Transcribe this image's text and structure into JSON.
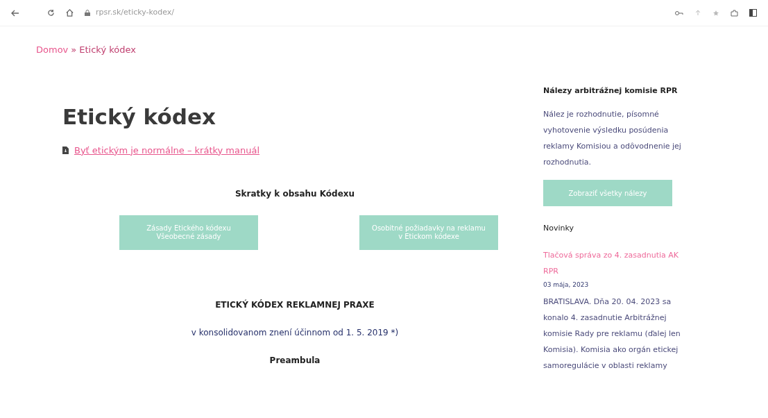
{
  "browser": {
    "address": "rpsr.sk/eticky-kodex/"
  },
  "breadcrumb": [
    {
      "label": "Domov",
      "kind": "link"
    },
    {
      "label": "»",
      "kind": "text"
    },
    {
      "label": "Etický kódex",
      "kind": "text"
    }
  ],
  "page": {
    "title": "Etický kódex",
    "download_link": "Byť etickým je normálne – krátky manuál",
    "shortcuts_heading": "Skratky k obsahu Kódexu",
    "shortcut_buttons": [
      {
        "line1": "Zásady Etického kódexu",
        "line2": "Všeobecné zásady"
      },
      {
        "line1": "Osobitné požiadavky na reklamu",
        "line2": "v Etickom kódexe"
      }
    ],
    "code_title": "ETICKÝ KÓDEX REKLAMNEJ PRAXE",
    "code_subtitle": "v konsolidovanom znení účinnom od 1. 5. 2019 *)",
    "section": "Preambula"
  },
  "sidebar": {
    "findings": {
      "title": "Nálezy arbitrážnej komisie RPR",
      "text": "Nález je rozhodnutie, písomné vyhotovenie výsledku posúdenia reklamy Komisiou a odôvodnenie jej rozhodnutia.",
      "button": "Zobraziť všetky nálezy"
    },
    "news": {
      "title": "Novinky",
      "items": [
        {
          "headline": "Tlačová správa zo 4. zasadnutia AK RPR",
          "date": "03 mája, 2023",
          "text": "BRATISLAVA. Dňa 20. 04. 2023 sa konalo 4. zasadnutie Arbitrážnej komisie Rady pre reklamu (ďalej len Komisia). Komisia ako orgán etickej samoregulácie v oblasti reklamy"
        }
      ]
    }
  }
}
